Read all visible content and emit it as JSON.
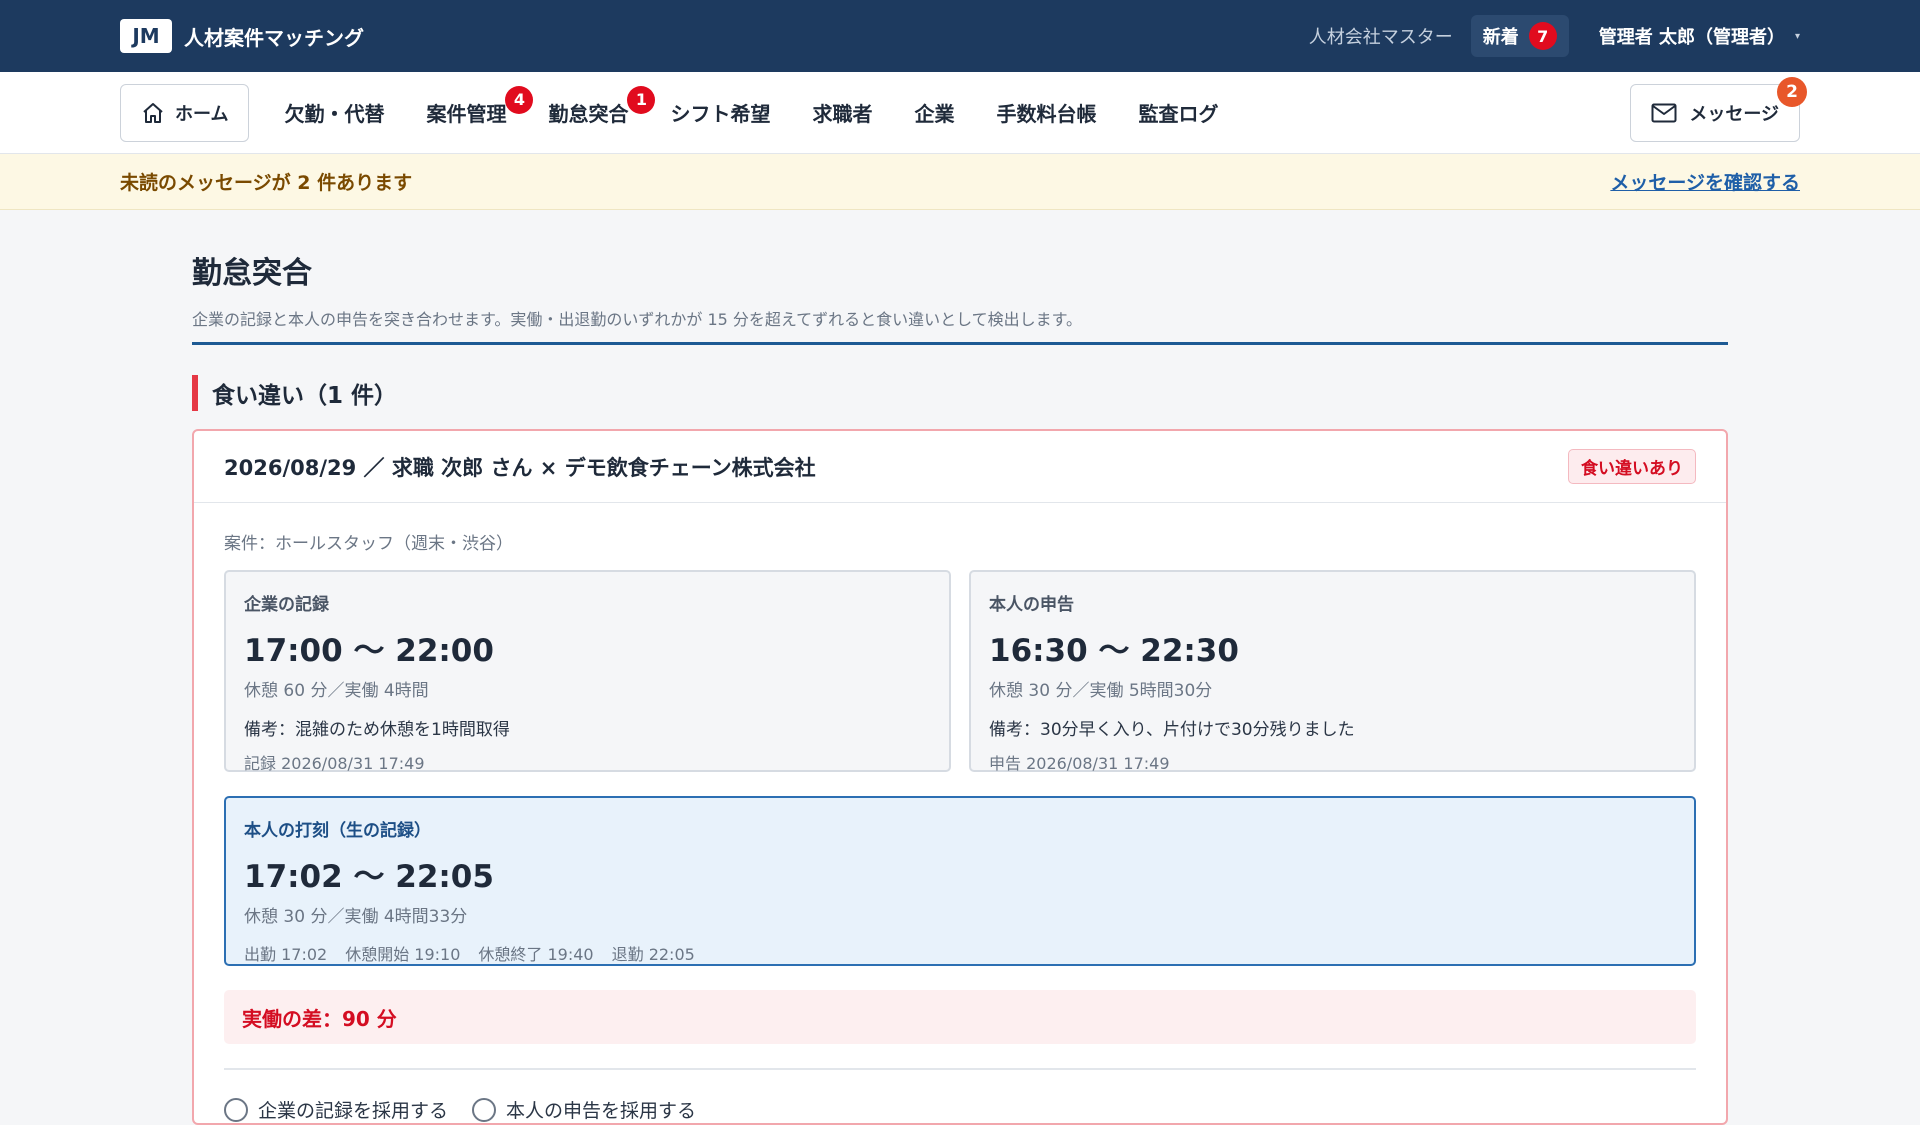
{
  "header": {
    "logo": "JM",
    "app_name": "人材案件マッチング",
    "org": "人材会社マスター",
    "new_label": "新着",
    "new_count": "7",
    "user": "管理者 太郎（管理者）",
    "caret": "▾"
  },
  "nav": {
    "home": "ホーム",
    "items": [
      {
        "label": "欠勤・代替",
        "badge": ""
      },
      {
        "label": "案件管理",
        "badge": "4"
      },
      {
        "label": "勤怠突合",
        "badge": "1"
      },
      {
        "label": "シフト希望",
        "badge": ""
      },
      {
        "label": "求職者",
        "badge": ""
      },
      {
        "label": "企業",
        "badge": ""
      },
      {
        "label": "手数料台帳",
        "badge": ""
      },
      {
        "label": "監査ログ",
        "badge": ""
      }
    ],
    "message_label": "メッセージ",
    "message_count": "2"
  },
  "notice": {
    "text": "未読のメッセージが 2 件あります",
    "link": "メッセージを確認する"
  },
  "page": {
    "title": "勤怠突合",
    "subtitle": "企業の記録と本人の申告を突き合わせます。実働・出退勤のいずれかが 15 分を超えてずれると食い違いとして検出します。"
  },
  "section": {
    "title": "食い違い（1 件）"
  },
  "card": {
    "title": "2026/08/29 ／ 求職 次郎 さん × デモ飲食チェーン株式会社",
    "badge": "食い違いあり",
    "project": "案件：ホールスタッフ（週末・渋谷）",
    "company": {
      "label": "企業の記録",
      "time": "17:00 〜 22:00",
      "meta": "休憩 60 分／実働 4時間",
      "note": "備考：混雑のため休憩を1時間取得",
      "stamp": "記録 2026/08/31 17:49"
    },
    "self": {
      "label": "本人の申告",
      "time": "16:30 〜 22:30",
      "meta": "休憩 30 分／実働 5時間30分",
      "note": "備考：30分早く入り、片付けで30分残りました",
      "stamp": "申告 2026/08/31 17:49"
    },
    "punch": {
      "label": "本人の打刻（生の記録）",
      "time": "17:02 〜 22:05",
      "meta": "休憩 30 分／実働 4時間33分",
      "details": [
        "出勤 17:02",
        "休憩開始 19:10",
        "休憩終了 19:40",
        "退勤 22:05"
      ]
    },
    "diff": "実働の差：90 分",
    "options": [
      "企業の記録を採用する",
      "本人の申告を採用する"
    ]
  }
}
